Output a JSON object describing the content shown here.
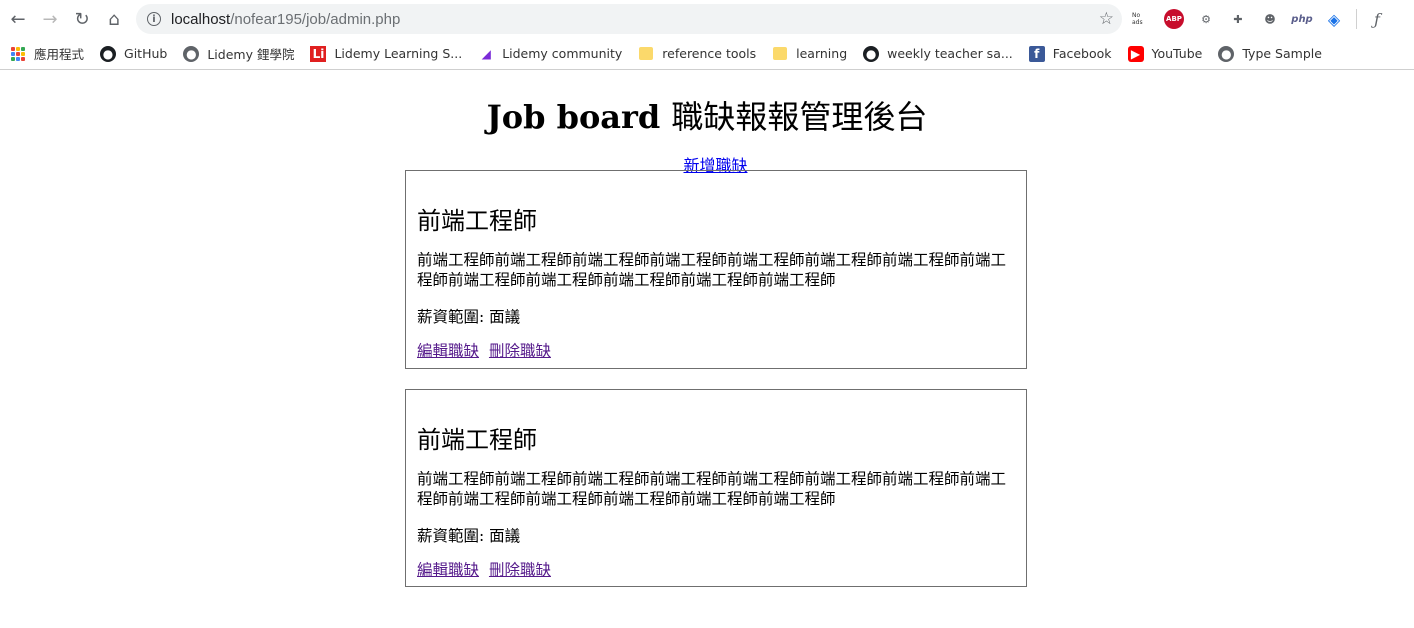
{
  "browser": {
    "url_host": "localhost",
    "url_path": "/nofear195/job/admin.php",
    "bookmarks": [
      {
        "label": "應用程式",
        "icon": "apps-grid-icon"
      },
      {
        "label": "GitHub",
        "icon": "github-icon"
      },
      {
        "label": "Lidemy 鋰學院",
        "icon": "globe-icon"
      },
      {
        "label": "Lidemy Learning S...",
        "icon": "lidemy-learning-icon"
      },
      {
        "label": "Lidemy community",
        "icon": "lidemy-community-icon"
      },
      {
        "label": "reference tools",
        "icon": "folder-icon"
      },
      {
        "label": "learning",
        "icon": "folder-icon"
      },
      {
        "label": "weekly teacher sa...",
        "icon": "github-icon"
      },
      {
        "label": "Facebook",
        "icon": "facebook-icon"
      },
      {
        "label": "YouTube",
        "icon": "youtube-icon"
      },
      {
        "label": "Type Sample",
        "icon": "globe-icon"
      }
    ],
    "extensions": {
      "noads": "No ads",
      "abp": "ABP",
      "php": "php"
    }
  },
  "page": {
    "title_en": "Job board",
    "title_zh": "職缺報報管理後台",
    "add_link": "新增職缺",
    "jobs": [
      {
        "title": "前端工程師",
        "description": "前端工程師前端工程師前端工程師前端工程師前端工程師前端工程師前端工程師前端工程師前端工程師前端工程師前端工程師前端工程師前端工程師",
        "salary": "薪資範圍: 面議",
        "edit_label": "編輯職缺",
        "delete_label": "刪除職缺"
      },
      {
        "title": "前端工程師",
        "description": "前端工程師前端工程師前端工程師前端工程師前端工程師前端工程師前端工程師前端工程師前端工程師前端工程師前端工程師前端工程師前端工程師",
        "salary": "薪資範圍: 面議",
        "edit_label": "編輯職缺",
        "delete_label": "刪除職缺"
      }
    ]
  },
  "colors": {
    "link": "#0000ee",
    "visited_link": "#551a8b",
    "card_border": "#6f6f6f"
  }
}
